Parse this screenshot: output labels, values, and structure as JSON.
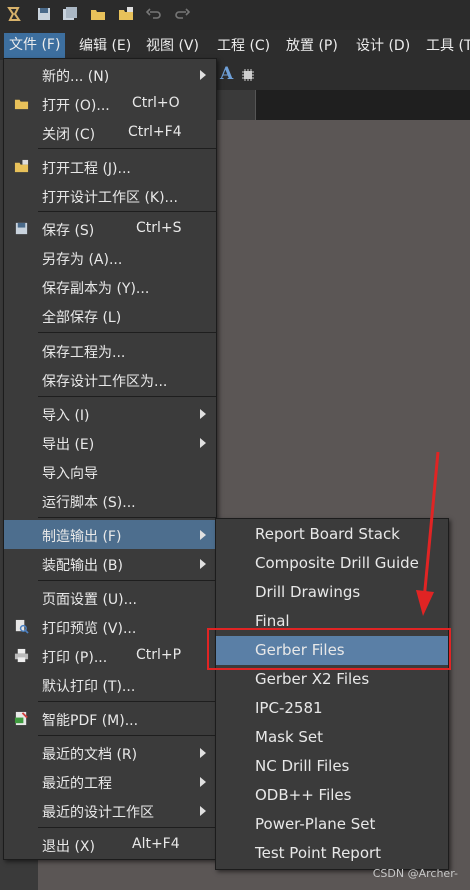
{
  "menubar": [
    {
      "label": "文件 (F)",
      "active": true
    },
    {
      "label": "编辑 (E)"
    },
    {
      "label": "视图 (V)"
    },
    {
      "label": "工程 (C)"
    },
    {
      "label": "放置 (P)"
    },
    {
      "label": "设计 (D)"
    },
    {
      "label": "工具 (T"
    }
  ],
  "file_menu": [
    {
      "label": "新的... (N)",
      "submenu": true
    },
    {
      "label": "打开 (O)...",
      "shortcut": "Ctrl+O",
      "icon": "open-folder-icon"
    },
    {
      "label": "关闭 (C)",
      "shortcut": "Ctrl+F4"
    },
    {
      "label": "打开工程 (J)...",
      "icon": "open-project-icon"
    },
    {
      "label": "打开设计工作区 (K)..."
    },
    {
      "label": "保存 (S)",
      "shortcut": "Ctrl+S",
      "icon": "save-icon"
    },
    {
      "label": "另存为 (A)..."
    },
    {
      "label": "保存副本为 (Y)..."
    },
    {
      "label": "全部保存 (L)"
    },
    {
      "label": "保存工程为..."
    },
    {
      "label": "保存设计工作区为..."
    },
    {
      "label": "导入 (I)",
      "submenu": true
    },
    {
      "label": "导出 (E)",
      "submenu": true
    },
    {
      "label": "导入向导"
    },
    {
      "label": "运行脚本 (S)..."
    },
    {
      "label": "制造输出 (F)",
      "submenu": true,
      "highlight": true
    },
    {
      "label": "装配输出 (B)",
      "submenu": true
    },
    {
      "label": "页面设置 (U)..."
    },
    {
      "label": "打印预览 (V)...",
      "icon": "print-preview-icon"
    },
    {
      "label": "打印 (P)...",
      "shortcut": "Ctrl+P",
      "icon": "printer-icon"
    },
    {
      "label": "默认打印 (T)..."
    },
    {
      "label": "智能PDF (M)...",
      "icon": "smart-pdf-icon"
    },
    {
      "label": "最近的文档 (R)",
      "submenu": true
    },
    {
      "label": "最近的工程",
      "submenu": true
    },
    {
      "label": "最近的设计工作区",
      "submenu": true
    },
    {
      "label": "退出 (X)",
      "shortcut": "Alt+F4"
    }
  ],
  "fab_submenu": [
    {
      "label": "Report Board Stack"
    },
    {
      "label": "Composite Drill Guide"
    },
    {
      "label": "Drill Drawings"
    },
    {
      "label": "Final"
    },
    {
      "label": "Gerber Files",
      "highlight": true
    },
    {
      "label": "Gerber X2 Files"
    },
    {
      "label": "IPC-2581"
    },
    {
      "label": "Mask Set"
    },
    {
      "label": "NC Drill Files"
    },
    {
      "label": "ODB++ Files"
    },
    {
      "label": "Power-Plane Set"
    },
    {
      "label": "Test Point Report"
    }
  ],
  "toolbar2_text": "A",
  "watermark": "CSDN @Archer-",
  "colors": {
    "highlight": "#4d6e8e",
    "callout": "#e02424",
    "arrow": "#e02424"
  }
}
